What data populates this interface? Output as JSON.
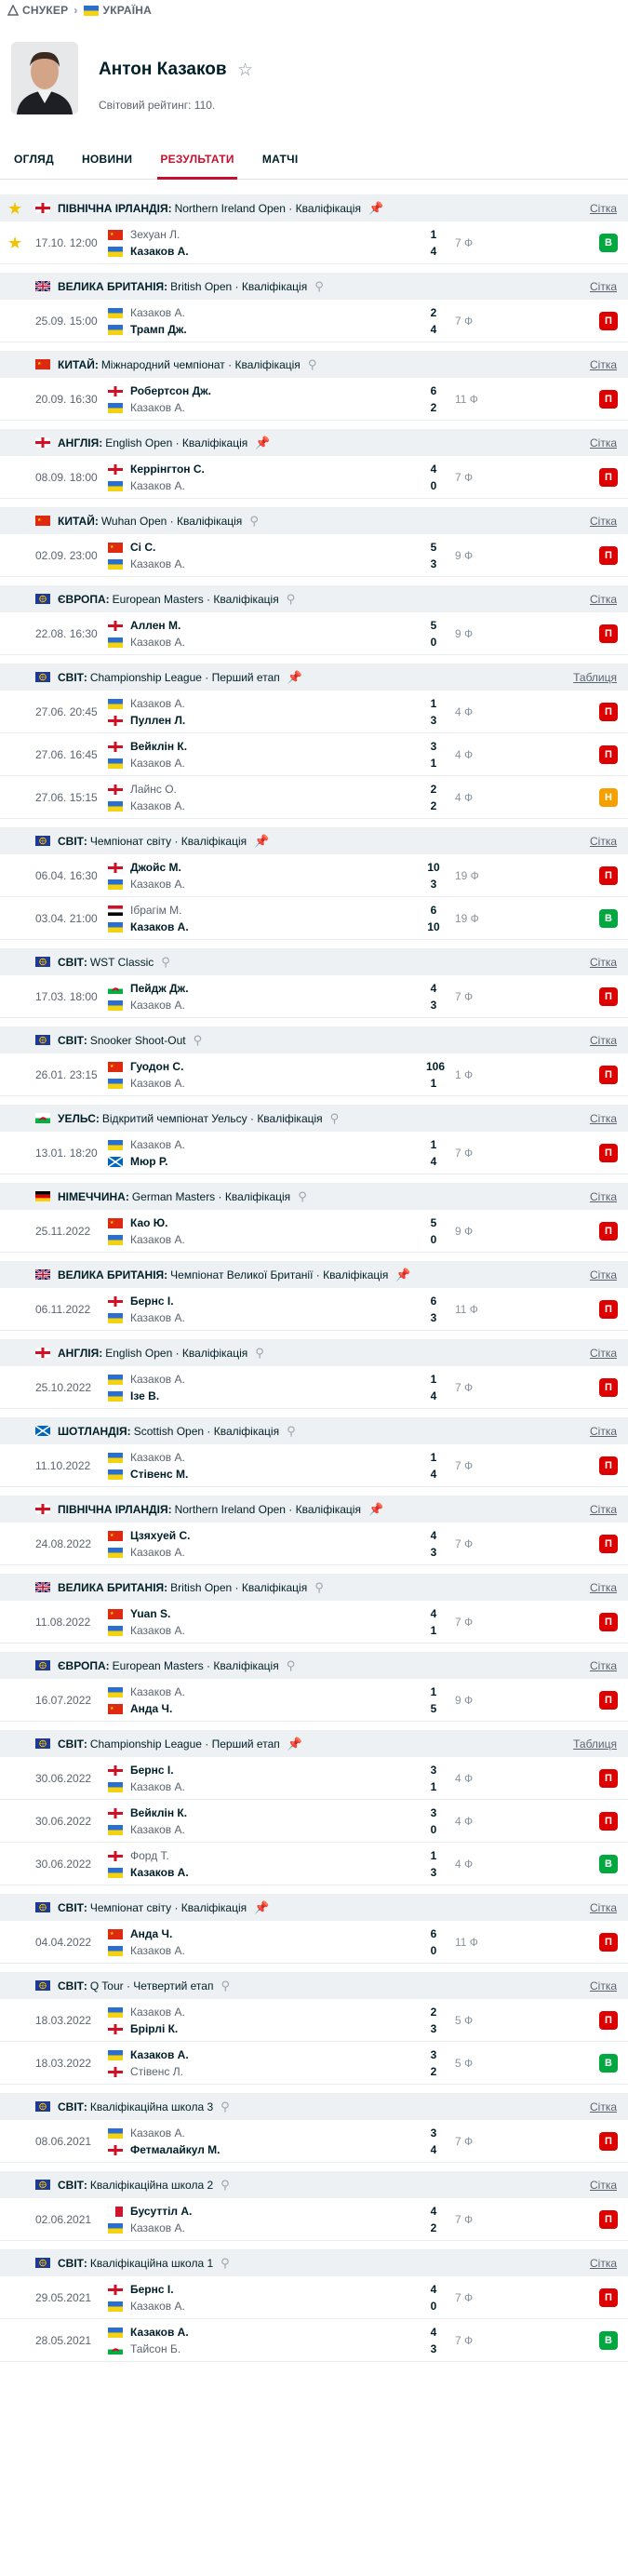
{
  "breadcrumb": {
    "sport": "СНУКЕР",
    "country": "УКРАЇНА"
  },
  "player": {
    "name": "Антон Казаков",
    "ranking": "Світовий рейтинг: 110."
  },
  "tabs": [
    {
      "label": "ОГЛЯД"
    },
    {
      "label": "НОВИНИ"
    },
    {
      "label": "РЕЗУЛЬТАТИ",
      "active": true
    },
    {
      "label": "МАТЧІ"
    }
  ],
  "colors": {
    "accent": "#c8102e",
    "loss": "#dc0000",
    "win": "#00a83f",
    "draw": "#f3a000",
    "pin_active": "#0a72d6"
  },
  "sections": [
    {
      "flag": "eng",
      "starred": true,
      "country": "ПІВНІЧНА ІРЛАНДІЯ:",
      "name": "Northern Ireland Open · Кваліфікація",
      "pinned": true,
      "link": "Сітка",
      "matches": [
        {
          "date": "17.10. 12:00",
          "starred": true,
          "p1": {
            "flag": "cn",
            "name": "Зехуан Л.",
            "score": "1"
          },
          "p2": {
            "flag": "ua",
            "name": "Казаков А.",
            "score": "4",
            "win": true
          },
          "frames": "7 Ф",
          "result": "В",
          "rtype": "W"
        }
      ]
    },
    {
      "flag": "gb",
      "country": "ВЕЛИКА БРИТАНІЯ:",
      "name": "British Open · Кваліфікація",
      "pinned": false,
      "link": "Сітка",
      "matches": [
        {
          "date": "25.09. 15:00",
          "p1": {
            "flag": "ua",
            "name": "Казаков А.",
            "score": "2"
          },
          "p2": {
            "flag": "ua",
            "name": "Трамп Дж.",
            "score": "4",
            "win": true
          },
          "frames": "7 Ф",
          "result": "П",
          "rtype": "L"
        }
      ]
    },
    {
      "flag": "cn",
      "country": "КИТАЙ:",
      "name": "Міжнародний чемпіонат · Кваліфікація",
      "pinned": false,
      "link": "Сітка",
      "matches": [
        {
          "date": "20.09. 16:30",
          "p1": {
            "flag": "eng",
            "name": "Робертсон Дж.",
            "score": "6",
            "win": true
          },
          "p2": {
            "flag": "ua",
            "name": "Казаков А.",
            "score": "2"
          },
          "frames": "11 Ф",
          "result": "П",
          "rtype": "L"
        }
      ]
    },
    {
      "flag": "eng",
      "country": "АНГЛІЯ:",
      "name": "English Open · Кваліфікація",
      "pinned": true,
      "link": "Сітка",
      "matches": [
        {
          "date": "08.09. 18:00",
          "p1": {
            "flag": "eng",
            "name": "Керрінгтон С.",
            "score": "4",
            "win": true
          },
          "p2": {
            "flag": "ua",
            "name": "Казаков А.",
            "score": "0"
          },
          "frames": "7 Ф",
          "result": "П",
          "rtype": "L"
        }
      ]
    },
    {
      "flag": "cn",
      "country": "КИТАЙ:",
      "name": "Wuhan Open · Кваліфікація",
      "pinned": false,
      "link": "Сітка",
      "matches": [
        {
          "date": "02.09. 23:00",
          "p1": {
            "flag": "cn",
            "name": "Сі С.",
            "score": "5",
            "win": true
          },
          "p2": {
            "flag": "ua",
            "name": "Казаков А.",
            "score": "3"
          },
          "frames": "9 Ф",
          "result": "П",
          "rtype": "L"
        }
      ]
    },
    {
      "flag": "world",
      "country": "ЄВРОПА:",
      "name": "European Masters · Кваліфікація",
      "pinned": false,
      "link": "Сітка",
      "matches": [
        {
          "date": "22.08. 16:30",
          "p1": {
            "flag": "eng",
            "name": "Аллен М.",
            "score": "5",
            "win": true
          },
          "p2": {
            "flag": "ua",
            "name": "Казаков А.",
            "score": "0"
          },
          "frames": "9 Ф",
          "result": "П",
          "rtype": "L"
        }
      ]
    },
    {
      "flag": "world",
      "country": "СВІТ:",
      "name": "Championship League · Перший етап",
      "pinned": true,
      "link": "Таблиця",
      "matches": [
        {
          "date": "27.06. 20:45",
          "p1": {
            "flag": "ua",
            "name": "Казаков А.",
            "score": "1"
          },
          "p2": {
            "flag": "eng",
            "name": "Пуллен Л.",
            "score": "3",
            "win": true
          },
          "frames": "4 Ф",
          "result": "П",
          "rtype": "L"
        },
        {
          "date": "27.06. 16:45",
          "p1": {
            "flag": "eng",
            "name": "Вейклін К.",
            "score": "3",
            "win": true
          },
          "p2": {
            "flag": "ua",
            "name": "Казаков А.",
            "score": "1"
          },
          "frames": "4 Ф",
          "result": "П",
          "rtype": "L"
        },
        {
          "date": "27.06. 15:15",
          "p1": {
            "flag": "eng",
            "name": "Лайнс О.",
            "score": "2"
          },
          "p2": {
            "flag": "ua",
            "name": "Казаков А.",
            "score": "2"
          },
          "frames": "4 Ф",
          "result": "Н",
          "rtype": "D"
        }
      ]
    },
    {
      "flag": "world",
      "country": "СВІТ:",
      "name": "Чемпіонат світу · Кваліфікація",
      "pinned": true,
      "link": "Сітка",
      "matches": [
        {
          "date": "06.04. 16:30",
          "p1": {
            "flag": "eng",
            "name": "Джойс М.",
            "score": "10",
            "win": true
          },
          "p2": {
            "flag": "ua",
            "name": "Казаков А.",
            "score": "3"
          },
          "frames": "19 Ф",
          "result": "П",
          "rtype": "L"
        },
        {
          "date": "03.04. 21:00",
          "p1": {
            "flag": "eg",
            "name": "Ібрагім М.",
            "score": "6"
          },
          "p2": {
            "flag": "ua",
            "name": "Казаков А.",
            "score": "10",
            "win": true
          },
          "frames": "19 Ф",
          "result": "В",
          "rtype": "W"
        }
      ]
    },
    {
      "flag": "world",
      "country": "СВІТ:",
      "name": "WST Classic",
      "pinned": false,
      "link": "Сітка",
      "matches": [
        {
          "date": "17.03. 18:00",
          "p1": {
            "flag": "wal",
            "name": "Пейдж Дж.",
            "score": "4",
            "win": true
          },
          "p2": {
            "flag": "ua",
            "name": "Казаков А.",
            "score": "3"
          },
          "frames": "7 Ф",
          "result": "П",
          "rtype": "L"
        }
      ]
    },
    {
      "flag": "world",
      "country": "СВІТ:",
      "name": "Snooker Shoot-Out",
      "pinned": false,
      "link": "Сітка",
      "matches": [
        {
          "date": "26.01. 23:15",
          "p1": {
            "flag": "cn",
            "name": "Гуодон С.",
            "score": "106",
            "win": true
          },
          "p2": {
            "flag": "ua",
            "name": "Казаков А.",
            "score": "1"
          },
          "frames": "1 Ф",
          "result": "П",
          "rtype": "L"
        }
      ]
    },
    {
      "flag": "wal",
      "country": "УЕЛЬС:",
      "name": "Відкритий чемпіонат Уельсу · Кваліфікація",
      "pinned": false,
      "link": "Сітка",
      "matches": [
        {
          "date": "13.01. 18:20",
          "p1": {
            "flag": "ua",
            "name": "Казаков А.",
            "score": "1"
          },
          "p2": {
            "flag": "sco",
            "name": "Мюр Р.",
            "score": "4",
            "win": true
          },
          "frames": "7 Ф",
          "result": "П",
          "rtype": "L"
        }
      ]
    },
    {
      "flag": "de",
      "country": "НІМЕЧЧИНА:",
      "name": "German Masters · Кваліфікація",
      "pinned": false,
      "link": "Сітка",
      "matches": [
        {
          "date": "25.11.2022",
          "p1": {
            "flag": "cn",
            "name": "Као Ю.",
            "score": "5",
            "win": true
          },
          "p2": {
            "flag": "ua",
            "name": "Казаков А.",
            "score": "0"
          },
          "frames": "9 Ф",
          "result": "П",
          "rtype": "L"
        }
      ]
    },
    {
      "flag": "gb",
      "country": "ВЕЛИКА БРИТАНІЯ:",
      "name": "Чемпіонат Великої Британії · Кваліфікація",
      "pinned": true,
      "link": "Сітка",
      "matches": [
        {
          "date": "06.11.2022",
          "p1": {
            "flag": "eng",
            "name": "Бернс І.",
            "score": "6",
            "win": true
          },
          "p2": {
            "flag": "ua",
            "name": "Казаков А.",
            "score": "3"
          },
          "frames": "11 Ф",
          "result": "П",
          "rtype": "L"
        }
      ]
    },
    {
      "flag": "eng",
      "country": "АНГЛІЯ:",
      "name": "English Open · Кваліфікація",
      "pinned": false,
      "link": "Сітка",
      "matches": [
        {
          "date": "25.10.2022",
          "p1": {
            "flag": "ua",
            "name": "Казаков А.",
            "score": "1"
          },
          "p2": {
            "flag": "ua",
            "name": "Ізе В.",
            "score": "4",
            "win": true
          },
          "frames": "7 Ф",
          "result": "П",
          "rtype": "L"
        }
      ]
    },
    {
      "flag": "sco",
      "country": "ШОТЛАНДІЯ:",
      "name": "Scottish Open · Кваліфікація",
      "pinned": false,
      "link": "Сітка",
      "matches": [
        {
          "date": "11.10.2022",
          "p1": {
            "flag": "ua",
            "name": "Казаков А.",
            "score": "1"
          },
          "p2": {
            "flag": "ua",
            "name": "Стівенс М.",
            "score": "4",
            "win": true
          },
          "frames": "7 Ф",
          "result": "П",
          "rtype": "L"
        }
      ]
    },
    {
      "flag": "eng",
      "country": "ПІВНІЧНА ІРЛАНДІЯ:",
      "name": "Northern Ireland Open · Кваліфікація",
      "pinned": true,
      "link": "Сітка",
      "matches": [
        {
          "date": "24.08.2022",
          "p1": {
            "flag": "cn",
            "name": "Цзяхуей С.",
            "score": "4",
            "win": true
          },
          "p2": {
            "flag": "ua",
            "name": "Казаков А.",
            "score": "3"
          },
          "frames": "7 Ф",
          "result": "П",
          "rtype": "L"
        }
      ]
    },
    {
      "flag": "gb",
      "country": "ВЕЛИКА БРИТАНІЯ:",
      "name": "British Open · Кваліфікація",
      "pinned": false,
      "link": "Сітка",
      "matches": [
        {
          "date": "11.08.2022",
          "p1": {
            "flag": "cn",
            "name": "Yuan S.",
            "score": "4",
            "win": true
          },
          "p2": {
            "flag": "ua",
            "name": "Казаков А.",
            "score": "1"
          },
          "frames": "7 Ф",
          "result": "П",
          "rtype": "L"
        }
      ]
    },
    {
      "flag": "world",
      "country": "ЄВРОПА:",
      "name": "European Masters · Кваліфікація",
      "pinned": false,
      "link": "Сітка",
      "matches": [
        {
          "date": "16.07.2022",
          "p1": {
            "flag": "ua",
            "name": "Казаков А.",
            "score": "1"
          },
          "p2": {
            "flag": "cn",
            "name": "Анда Ч.",
            "score": "5",
            "win": true
          },
          "frames": "9 Ф",
          "result": "П",
          "rtype": "L"
        }
      ]
    },
    {
      "flag": "world",
      "country": "СВІТ:",
      "name": "Championship League · Перший етап",
      "pinned": true,
      "link": "Таблиця",
      "matches": [
        {
          "date": "30.06.2022",
          "p1": {
            "flag": "eng",
            "name": "Бернс І.",
            "score": "3",
            "win": true
          },
          "p2": {
            "flag": "ua",
            "name": "Казаков А.",
            "score": "1"
          },
          "frames": "4 Ф",
          "result": "П",
          "rtype": "L"
        },
        {
          "date": "30.06.2022",
          "p1": {
            "flag": "eng",
            "name": "Вейклін К.",
            "score": "3",
            "win": true
          },
          "p2": {
            "flag": "ua",
            "name": "Казаков А.",
            "score": "0"
          },
          "frames": "4 Ф",
          "result": "П",
          "rtype": "L"
        },
        {
          "date": "30.06.2022",
          "p1": {
            "flag": "eng",
            "name": "Форд Т.",
            "score": "1"
          },
          "p2": {
            "flag": "ua",
            "name": "Казаков А.",
            "score": "3",
            "win": true
          },
          "frames": "4 Ф",
          "result": "В",
          "rtype": "W"
        }
      ]
    },
    {
      "flag": "world",
      "country": "СВІТ:",
      "name": "Чемпіонат світу · Кваліфікація",
      "pinned": true,
      "link": "Сітка",
      "matches": [
        {
          "date": "04.04.2022",
          "p1": {
            "flag": "cn",
            "name": "Анда Ч.",
            "score": "6",
            "win": true
          },
          "p2": {
            "flag": "ua",
            "name": "Казаков А.",
            "score": "0"
          },
          "frames": "11 Ф",
          "result": "П",
          "rtype": "L"
        }
      ]
    },
    {
      "flag": "world",
      "country": "СВІТ:",
      "name": "Q Tour · Четвертий етап",
      "pinned": false,
      "link": "Сітка",
      "matches": [
        {
          "date": "18.03.2022",
          "p1": {
            "flag": "ua",
            "name": "Казаков А.",
            "score": "2"
          },
          "p2": {
            "flag": "eng",
            "name": "Брірлі К.",
            "score": "3",
            "win": true
          },
          "frames": "5 Ф",
          "result": "П",
          "rtype": "L"
        },
        {
          "date": "18.03.2022",
          "p1": {
            "flag": "ua",
            "name": "Казаков А.",
            "score": "3",
            "win": true
          },
          "p2": {
            "flag": "eng",
            "name": "Стівенс Л.",
            "score": "2"
          },
          "frames": "5 Ф",
          "result": "В",
          "rtype": "W"
        }
      ]
    },
    {
      "flag": "world",
      "country": "СВІТ:",
      "name": "Кваліфікаційна школа 3",
      "pinned": false,
      "link": "Сітка",
      "matches": [
        {
          "date": "08.06.2021",
          "p1": {
            "flag": "ua",
            "name": "Казаков А.",
            "score": "3"
          },
          "p2": {
            "flag": "eng",
            "name": "Фетмалайкул М.",
            "score": "4",
            "win": true
          },
          "frames": "7 Ф",
          "result": "П",
          "rtype": "L"
        }
      ]
    },
    {
      "flag": "world",
      "country": "СВІТ:",
      "name": "Кваліфікаційна школа 2",
      "pinned": false,
      "link": "Сітка",
      "matches": [
        {
          "date": "02.06.2021",
          "p1": {
            "flag": "mt",
            "name": "Бусуттіл А.",
            "score": "4",
            "win": true
          },
          "p2": {
            "flag": "ua",
            "name": "Казаков А.",
            "score": "2"
          },
          "frames": "7 Ф",
          "result": "П",
          "rtype": "L"
        }
      ]
    },
    {
      "flag": "world",
      "country": "СВІТ:",
      "name": "Кваліфікаційна школа 1",
      "pinned": false,
      "link": "Сітка",
      "matches": [
        {
          "date": "29.05.2021",
          "p1": {
            "flag": "eng",
            "name": "Бернс І.",
            "score": "4",
            "win": true
          },
          "p2": {
            "flag": "ua",
            "name": "Казаков А.",
            "score": "0"
          },
          "frames": "7 Ф",
          "result": "П",
          "rtype": "L"
        },
        {
          "date": "28.05.2021",
          "p1": {
            "flag": "ua",
            "name": "Казаков А.",
            "score": "4",
            "win": true
          },
          "p2": {
            "flag": "wal",
            "name": "Тайсон Б.",
            "score": "3"
          },
          "frames": "7 Ф",
          "result": "В",
          "rtype": "W"
        }
      ]
    }
  ]
}
